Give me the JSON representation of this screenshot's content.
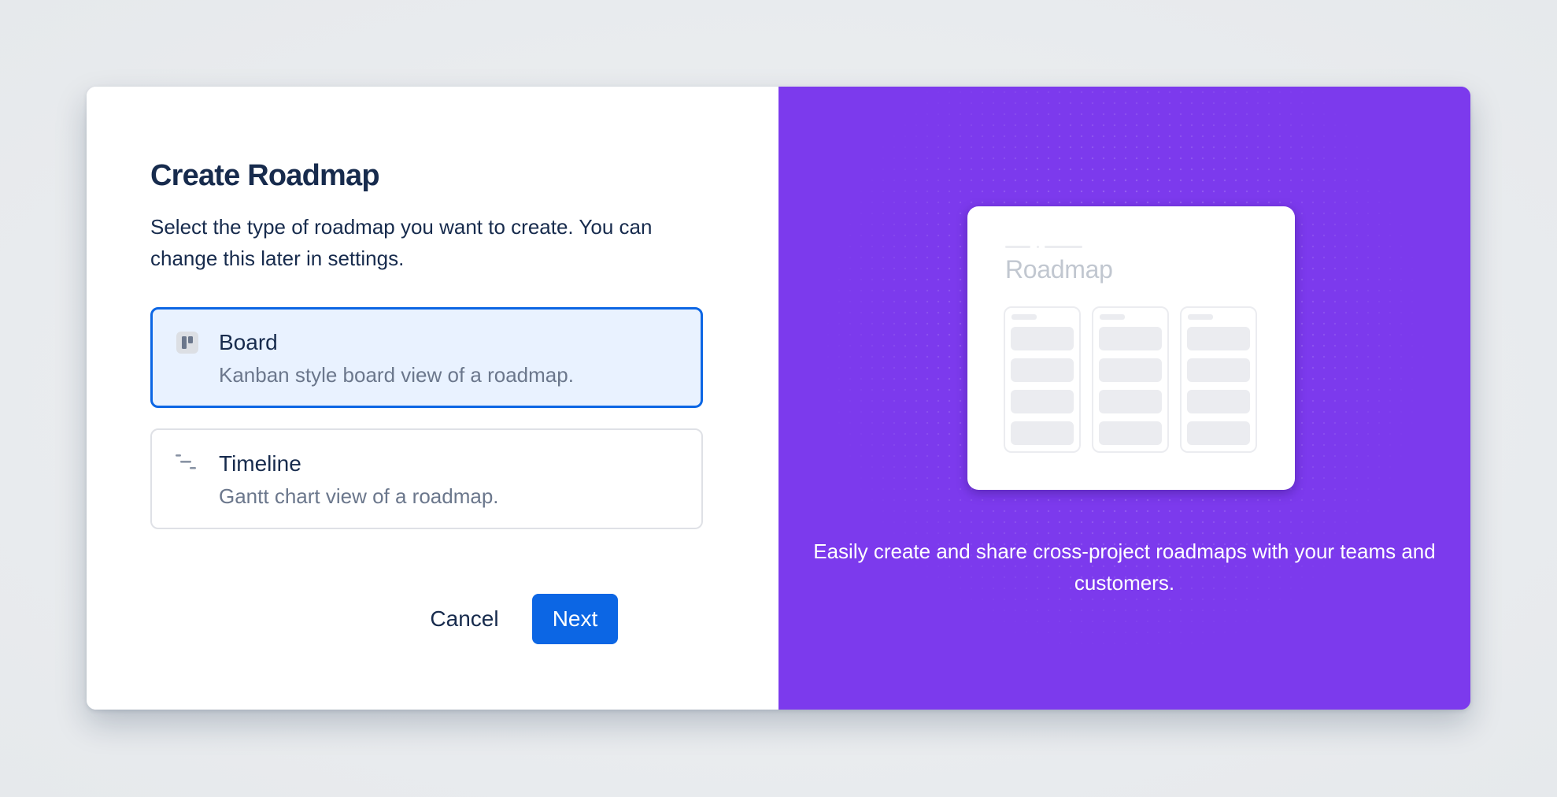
{
  "dialog": {
    "title": "Create Roadmap",
    "description": "Select the type of roadmap you want to create. You can change this later in settings."
  },
  "options": [
    {
      "label": "Board",
      "description": "Kanban style board view of a roadmap.",
      "icon": "board-icon",
      "selected": true
    },
    {
      "label": "Timeline",
      "description": "Gantt chart view of a roadmap.",
      "icon": "timeline-icon",
      "selected": false
    }
  ],
  "actions": {
    "cancel_label": "Cancel",
    "next_label": "Next"
  },
  "promo": {
    "preview_title": "Roadmap",
    "tagline": "Easily create and share cross-project roadmaps with your teams and customers."
  },
  "colors": {
    "accent": "#0c66e4",
    "selected_bg": "#e9f2ff",
    "promo_bg": "#7c3aed",
    "text": "#172b4d",
    "subtle_text": "#6b778c"
  }
}
